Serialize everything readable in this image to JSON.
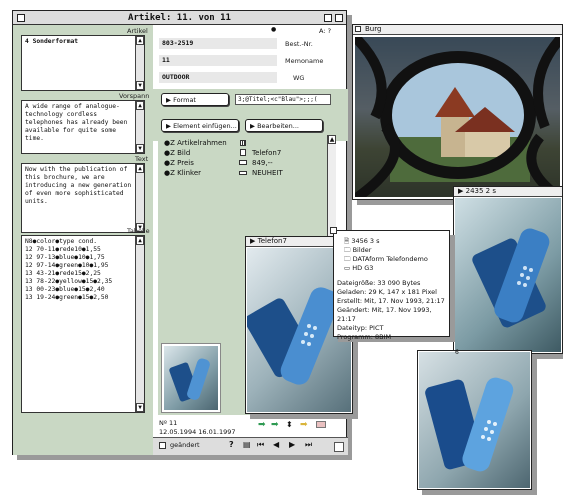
{
  "main_window": {
    "title": "Artikel: 11. von 11",
    "dot": "●",
    "a_marker": "A: ?",
    "labels": {
      "artikel": "Artikel",
      "vorspann": "Vorspann",
      "text": "Text",
      "tabelle": "Tabelle",
      "best_nr": "Best.-Nr.",
      "memoname": "Memoname",
      "wg": "WG"
    },
    "artikel_value": "4 Sonderformat",
    "vorspann_text": "A wide range of analogue-technology cordless telephones has already been available for quite some time.",
    "text_text": "Now with the publication of this brochure, we are introducing a new generation of even more sophisticated units.",
    "tabelle_rows": [
      "N8●color●type cond.",
      "12 70-11●rede10●1,55",
      "12 97-13●blue●10●1,75",
      "12 97-14●green●10●1,95",
      "13 43-21●rede15●2,25",
      "13 78-22●yellow●15●2,35",
      "13 00-23●blue●15●2,40",
      "13 19-24●green●15●2,50"
    ],
    "best_nr_value": "803-2519",
    "memoname_value": "11",
    "wg_value": "OUTDOOR",
    "format_button": "Format",
    "format_value": "3;@Titel;<c\"Blau\">;;;(",
    "element_button": "Element einfügen...",
    "bearbeiten_button": "Bearbeiten...",
    "elements": [
      {
        "name": "●Z Artikelrahmen",
        "icon": "grid-icon",
        "value": ""
      },
      {
        "name": "●Z Bild",
        "icon": "document-icon",
        "value": "Telefon7"
      },
      {
        "name": "●Z Preis",
        "icon": "price-icon",
        "value": "849,--"
      },
      {
        "name": "●Z Klinker",
        "icon": "tag-icon",
        "value": "NEUHEIT"
      }
    ],
    "nr": "Nº 11",
    "dates": "12.05.1994  16.01.1997",
    "geaendert": "geändert",
    "question": "?"
  },
  "burg_window": {
    "title": "Burg"
  },
  "win2435": {
    "title": "2435 2 s"
  },
  "telefon_window": {
    "title": "Telefon7"
  },
  "info_panel": {
    "path": [
      {
        "icon": "document-icon",
        "text": "3456 3 s"
      },
      {
        "icon": "folder-icon",
        "text": "Bilder"
      },
      {
        "icon": "folder-icon",
        "text": "DATAform Telefondemo"
      },
      {
        "icon": "disk-icon",
        "text": "HD G3"
      }
    ],
    "details": [
      "Dateigröße: 33 090 Bytes",
      "Geladen: 29 K, 147 x 181 Pixel",
      "Erstellt: Mit, 17. Nov 1993, 21:17",
      "Geändert: Mit, 17. Nov 1993, 21:17",
      "Dateityp: PICT",
      "Programm: 8BIM"
    ]
  },
  "colors": {
    "accent_green": "#c9d8c4",
    "arrow_green": "#2e9a52",
    "arrow_yellow": "#d9b43a"
  }
}
